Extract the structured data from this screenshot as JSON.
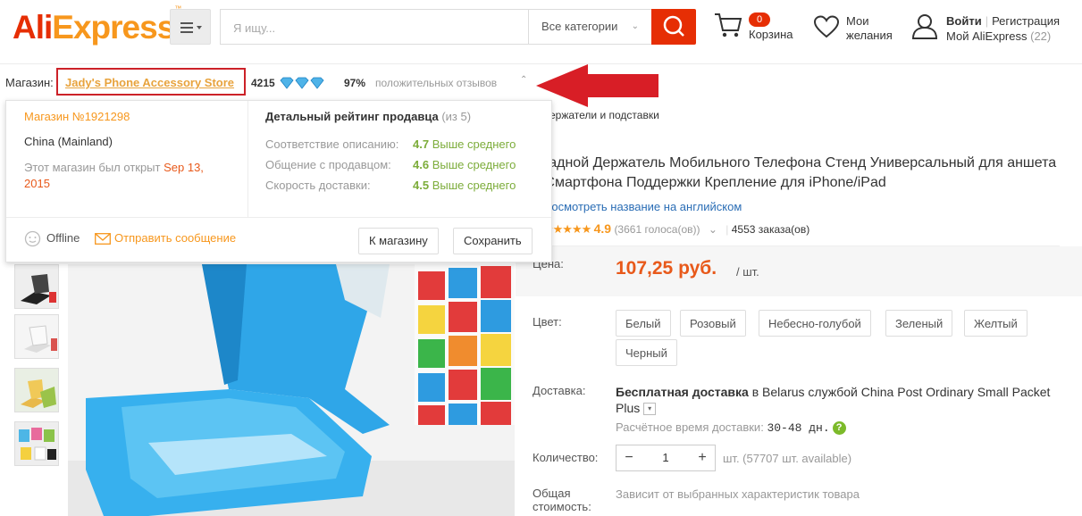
{
  "header": {
    "logo_ali": "Ali",
    "logo_express": "Express",
    "logo_tm": "™",
    "search": {
      "placeholder": "Я ищу...",
      "category": "Все категории"
    },
    "cart": {
      "count": "0",
      "label": "Корзина"
    },
    "wishlist": {
      "line1": "Мои",
      "line2": "желания"
    },
    "account": {
      "login": "Войти",
      "register": "Регистрация",
      "my": "Мой AliExpress",
      "my_count": "(22)"
    }
  },
  "store_bar": {
    "label": "Магазин:",
    "store_name": "Jady's Phone Accessory Store",
    "feedback_score": "4215",
    "positive_pct": "97%",
    "positive_label": "положительных отзывов"
  },
  "store_popup": {
    "store_number": "Магазин №1921298",
    "country": "China (Mainland)",
    "opened_prefix": "Этот магазин был открыт",
    "opened_date": "Sep 13, 2015",
    "rating_title": "Детальный рейтинг продавца",
    "rating_scale": "(из 5)",
    "ratings": [
      {
        "label": "Соответствие описанию:",
        "value": "4.7",
        "note": "Выше среднего"
      },
      {
        "label": "Общение с продавцом:",
        "value": "4.6",
        "note": "Выше среднего"
      },
      {
        "label": "Скорость доставки:",
        "value": "4.5",
        "note": "Выше среднего"
      }
    ],
    "status": "Offline",
    "message_link": "Отправить сообщение",
    "to_store_button": "К магазину",
    "save_button": "Сохранить"
  },
  "breadcrumb_tail": "держатели и подставки",
  "product": {
    "title": "аладной Держатель Мобильного Телефона Стенд Универсальный для аншета и Смартфона Поддержки Крепление для iPhone/iPad",
    "translate_link": "Посмотреть название на английском",
    "rating": "4.9",
    "votes": "(3661 голоса(ов))",
    "orders": "4553 заказа(ов)",
    "price_label": "Цена:",
    "price": "107,25 руб.",
    "price_unit": "/ шт.",
    "color_label": "Цвет:",
    "colors": [
      "Белый",
      "Розовый",
      "Небесно-голубой",
      "Зеленый",
      "Желтый",
      "Черный"
    ],
    "shipping_label": "Доставка:",
    "shipping_bold": "Бесплатная доставка",
    "shipping_rest": " в Belarus службой China Post Ordinary Small Packet Plus",
    "eta_label": "Расчётное время доставки:",
    "eta_value": "30-48 дн.",
    "quantity_label": "Количество:",
    "quantity": "1",
    "quantity_avail": "шт. (57707 шт. available)",
    "total_label_1": "Общая",
    "total_label_2": "стоимость:",
    "total_text": "Зависит от выбранных характеристик товара"
  },
  "colors": {
    "brand_red": "#e62e04",
    "brand_orange": "#f7971d",
    "price": "#e8591a",
    "good": "#7cac3a",
    "link": "#2a6db5",
    "annotation": "#d81e26"
  },
  "icons": [
    "menu-icon",
    "search-icon",
    "cart-icon",
    "heart-icon",
    "user-icon",
    "diamond-icon",
    "chevron-up-icon",
    "smiley-icon",
    "envelope-icon",
    "help-icon",
    "arrow-annotation"
  ]
}
